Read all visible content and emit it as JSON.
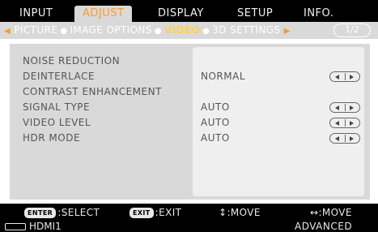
{
  "tabs": [
    {
      "label": "INPUT",
      "active": false
    },
    {
      "label": "ADJUST",
      "active": true
    },
    {
      "label": "DISPLAY",
      "active": false
    },
    {
      "label": "SETUP",
      "active": false
    },
    {
      "label": "INFO.",
      "active": false
    }
  ],
  "submenu": {
    "items": [
      "PICTURE",
      "IMAGE OPTIONS",
      "VIDEO",
      "3D SETTINGS"
    ],
    "active_index": 2,
    "page": "1/2"
  },
  "settings": [
    {
      "label": "NOISE REDUCTION",
      "value": "",
      "stepper": false
    },
    {
      "label": "DEINTERLACE",
      "value": "NORMAL",
      "stepper": true
    },
    {
      "label": "CONTRAST ENHANCEMENT",
      "value": "",
      "stepper": false
    },
    {
      "label": "SIGNAL TYPE",
      "value": "AUTO",
      "stepper": true
    },
    {
      "label": "VIDEO LEVEL",
      "value": "AUTO",
      "stepper": true
    },
    {
      "label": "HDR MODE",
      "value": "AUTO",
      "stepper": true
    }
  ],
  "help": {
    "enter_key": "ENTER",
    "enter_text": ":SELECT",
    "exit_key": "EXIT",
    "exit_text": ":EXIT",
    "move_vertical": "↕:MOVE",
    "move_horizontal": "↔:MOVE"
  },
  "status": {
    "source": "HDMI1",
    "mode": "ADVANCED"
  },
  "colors": {
    "active_tab_text": "#ff9a2a",
    "active_submenu_text": "#ffd24a",
    "panel_bg": "#d9d9d9"
  },
  "icons": {
    "prev_page": "chevron-left-icon",
    "next_page": "chevron-right-icon",
    "stepper": "left-right-stepper-icon",
    "source": "hdmi-cable-icon"
  }
}
